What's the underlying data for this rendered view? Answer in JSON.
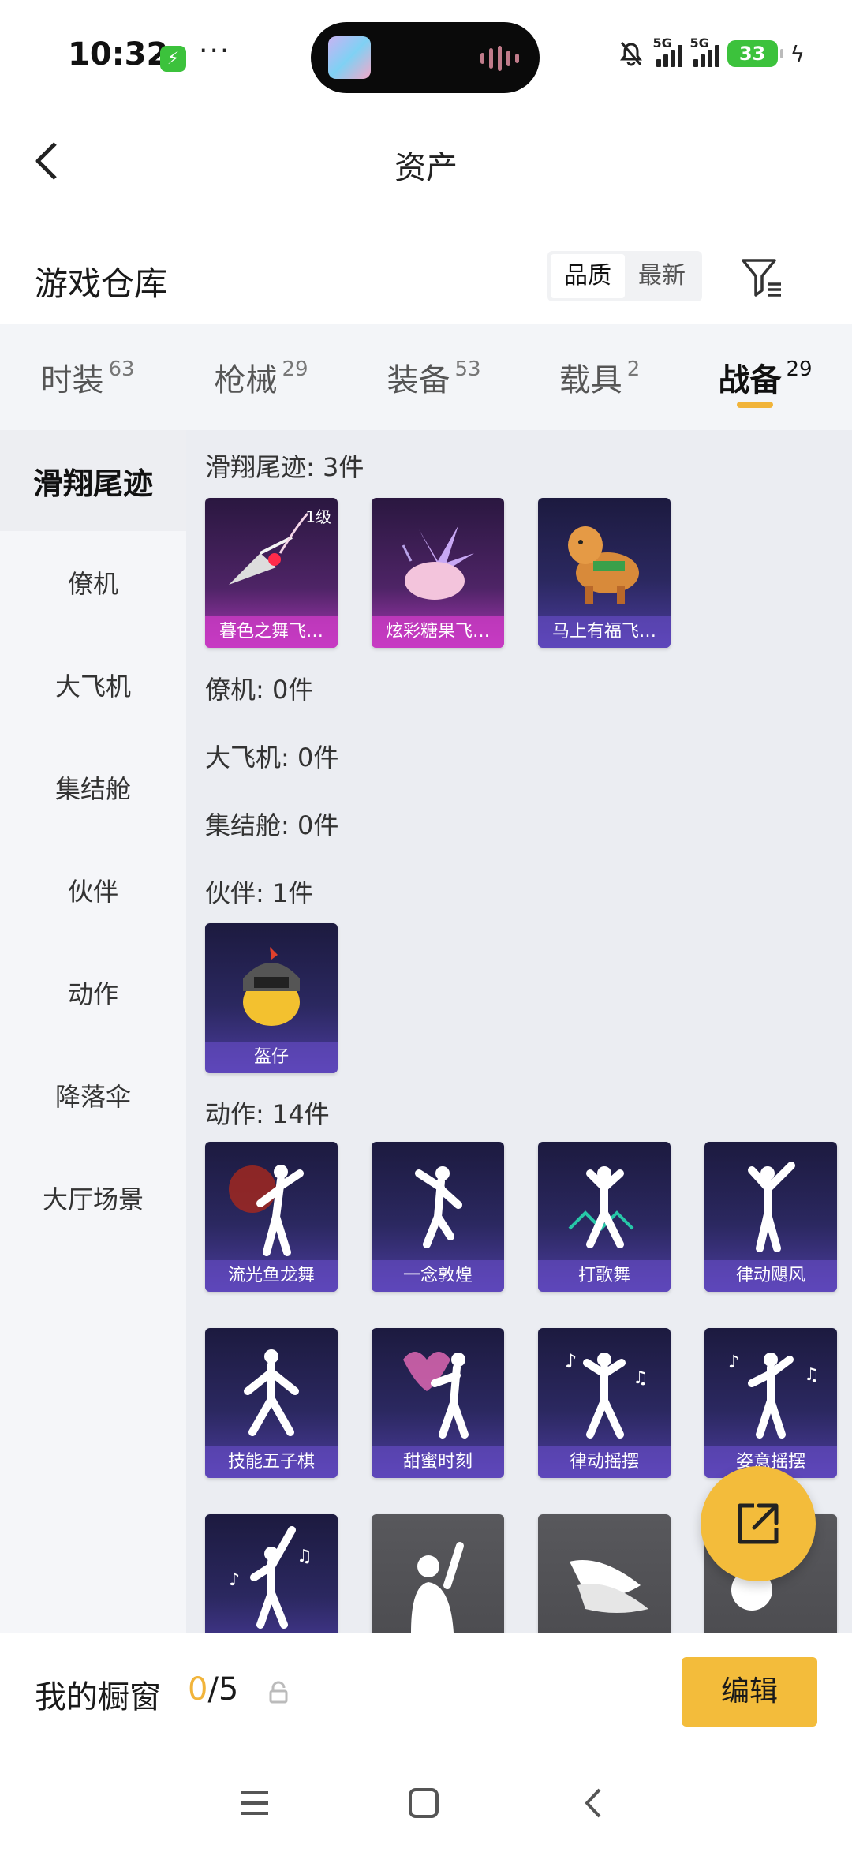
{
  "status_bar": {
    "time": "10:32",
    "dots": "···",
    "signal1": "5G",
    "signal2": "5G",
    "battery": "33"
  },
  "nav": {
    "title": "资产"
  },
  "warehouse": {
    "title": "游戏仓库",
    "sort_options": [
      "品质",
      "最新"
    ],
    "active_sort": "品质"
  },
  "tabs": [
    {
      "label": "时装",
      "count": "63"
    },
    {
      "label": "枪械",
      "count": "29"
    },
    {
      "label": "装备",
      "count": "53"
    },
    {
      "label": "载具",
      "count": "2"
    },
    {
      "label": "战备",
      "count": "29"
    }
  ],
  "active_tab": "战备",
  "side_menu": [
    "滑翔尾迹",
    "僚机",
    "大飞机",
    "集结舱",
    "伙伴",
    "动作",
    "降落伞",
    "大厅场景"
  ],
  "active_side": "滑翔尾迹",
  "sections": {
    "glide": {
      "title": "滑翔尾迹: 3件",
      "items": [
        "暮色之舞飞…",
        "炫彩糖果飞…",
        "马上有福飞…"
      ],
      "level": "1级"
    },
    "wingman": {
      "title": "僚机: 0件"
    },
    "big_plane": {
      "title": "大飞机: 0件"
    },
    "assembly": {
      "title": "集结舱: 0件"
    },
    "partner": {
      "title": "伙伴: 1件",
      "items": [
        "盔仔"
      ]
    },
    "emote": {
      "title": "动作: 14件",
      "items": [
        "流光鱼龙舞",
        "一念敦煌",
        "打歌舞",
        "律动飓风",
        "技能五子棋",
        "甜蜜时刻",
        "律动摇摆",
        "姿意摇摆"
      ]
    }
  },
  "showcase": {
    "label": "我的橱窗",
    "current": "0",
    "total": "/5",
    "edit": "编辑"
  }
}
